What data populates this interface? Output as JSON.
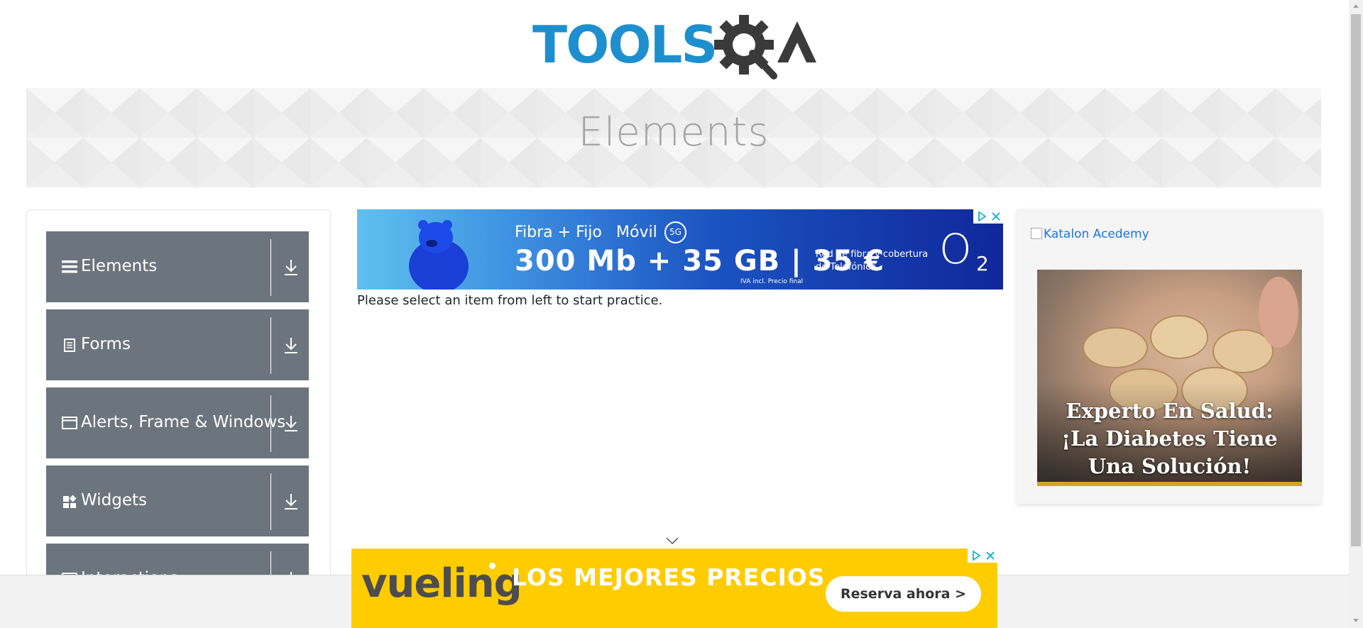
{
  "header": {
    "logo_text": "TOOLSQA"
  },
  "banner": {
    "title": "Elements"
  },
  "sidebar": {
    "groups": [
      {
        "label": "Elements",
        "icon": "hamburger-icon"
      },
      {
        "label": "Forms",
        "icon": "document-icon"
      },
      {
        "label": "Alerts, Frame & Windows",
        "icon": "window-icon"
      },
      {
        "label": "Widgets",
        "icon": "widgets-icon"
      },
      {
        "label": "Interactions",
        "icon": "interactions-icon"
      }
    ]
  },
  "main": {
    "message": "Please select an item from left to start practice."
  },
  "ad_top": {
    "line1_a": "Fibra + Fijo",
    "line1_b": "Móvil",
    "badge": "5G",
    "line2": "300 Mb + 35 GB | 35 €",
    "fine_print": "IVA incl. Precio final",
    "coverage": "Red de fibra y cobertura de Telefónica",
    "brand": "O",
    "brand_sub": "2"
  },
  "ad_right": {
    "alt_text": "Katalon Acedemy",
    "headline": "Experto En Salud: ¡La Diabetes Tiene Una Solución!"
  },
  "ad_bottom": {
    "brand": "vueling",
    "slogan": "LOS MEJORES PRECIOS",
    "cta": "Reserva ahora  >"
  },
  "colors": {
    "logo_blue": "#1e8fce",
    "logo_dark": "#3a3a3a",
    "sidebar_bg": "#6c757d",
    "banner_text": "#a4a4a4",
    "vueling_yellow": "#ffcc00"
  }
}
